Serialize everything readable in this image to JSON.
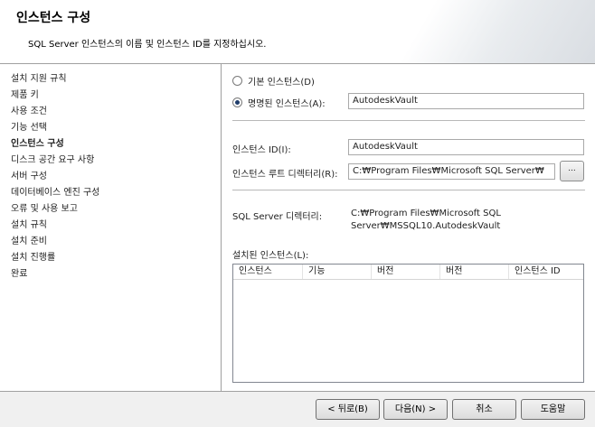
{
  "header": {
    "title": "인스턴스 구성",
    "subtitle": "SQL Server 인스턴스의 이름 및 인스턴스 ID를 지정하십시오."
  },
  "sidebar": {
    "items": [
      {
        "label": "설치 지원 규칙"
      },
      {
        "label": "제품 키"
      },
      {
        "label": "사용 조건"
      },
      {
        "label": "기능 선택"
      },
      {
        "label": "인스턴스 구성"
      },
      {
        "label": "디스크 공간 요구 사항"
      },
      {
        "label": "서버 구성"
      },
      {
        "label": "데이터베이스 엔진 구성"
      },
      {
        "label": "오류 및 사용 보고"
      },
      {
        "label": "설치 규칙"
      },
      {
        "label": "설치 준비"
      },
      {
        "label": "설치 진행률"
      },
      {
        "label": "완료"
      }
    ],
    "active_index": 4
  },
  "form": {
    "default_instance_label": "기본 인스턴스(D)",
    "named_instance_label": "명명된 인스턴스(A):",
    "selected_option": "named",
    "named_instance_value": "AutodeskVault",
    "instance_id_label": "인스턴스 ID(I):",
    "instance_id_value": "AutodeskVault",
    "instance_root_label": "인스턴스 루트 디렉터리(R):",
    "instance_root_value": "C:₩Program Files₩Microsoft SQL Server₩",
    "browse_label": "...",
    "sql_server_dir_label": "SQL Server 디렉터리:",
    "sql_server_dir_line1": "C:₩Program Files₩Microsoft SQL",
    "sql_server_dir_line2": "Server₩MSSQL10.AutodeskVault",
    "installed_instances_label": "설치된 인스턴스(L):"
  },
  "installed_instances": {
    "columns": [
      "인스턴스",
      "기능",
      "버전",
      "버전",
      "인스턴스 ID"
    ],
    "rows": []
  },
  "footer": {
    "back_label": "< 뒤로(B)",
    "next_label": "다음(N) >",
    "cancel_label": "취소",
    "help_label": "도움말"
  }
}
